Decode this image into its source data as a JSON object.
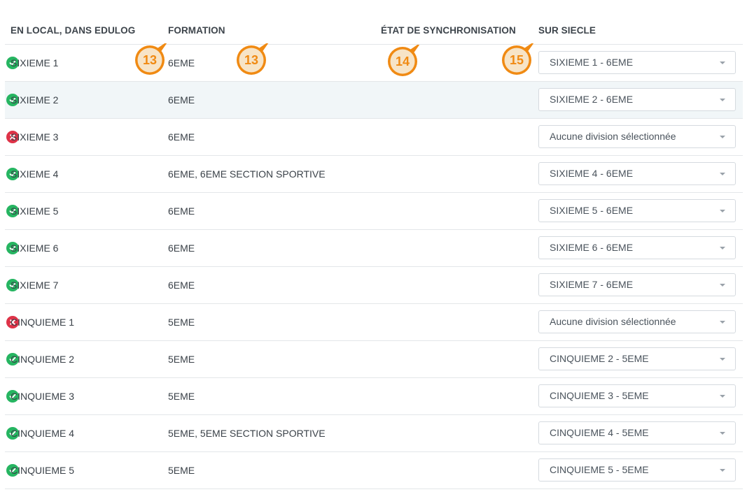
{
  "headers": {
    "local": "EN LOCAL, DANS EDULOG",
    "formation": "FORMATION",
    "sync": "ÉTAT DE SYNCHRONISATION",
    "siecle": "SUR SIECLE"
  },
  "rows": [
    {
      "local": "SIXIEME 1",
      "formation": "6EME",
      "status": "ok",
      "siecle": "SIXIEME 1 - 6EME"
    },
    {
      "local": "SIXIEME 2",
      "formation": "6EME",
      "status": "ok",
      "siecle": "SIXIEME 2 - 6EME"
    },
    {
      "local": "SIXIEME 3",
      "formation": "6EME",
      "status": "error",
      "siecle": "Aucune division sélectionnée"
    },
    {
      "local": "SIXIEME 4",
      "formation": "6EME, 6EME SECTION SPORTIVE",
      "status": "ok",
      "siecle": "SIXIEME 4 - 6EME"
    },
    {
      "local": "SIXIEME 5",
      "formation": "6EME",
      "status": "ok",
      "siecle": "SIXIEME 5 - 6EME"
    },
    {
      "local": "SIXIEME 6",
      "formation": "6EME",
      "status": "ok",
      "siecle": "SIXIEME 6 - 6EME"
    },
    {
      "local": "SIXIEME 7",
      "formation": "6EME",
      "status": "ok",
      "siecle": "SIXIEME 7 - 6EME"
    },
    {
      "local": "CINQUIEME 1",
      "formation": "5EME",
      "status": "error",
      "siecle": "Aucune division sélectionnée"
    },
    {
      "local": "CINQUIEME 2",
      "formation": "5EME",
      "status": "ok",
      "siecle": "CINQUIEME 2 - 5EME"
    },
    {
      "local": "CINQUIEME 3",
      "formation": "5EME",
      "status": "ok",
      "siecle": "CINQUIEME 3 - 5EME"
    },
    {
      "local": "CINQUIEME 4",
      "formation": "5EME, 5EME SECTION SPORTIVE",
      "status": "ok",
      "siecle": "CINQUIEME 4 - 5EME"
    },
    {
      "local": "CINQUIEME 5",
      "formation": "5EME",
      "status": "ok",
      "siecle": "CINQUIEME 5 - 5EME"
    }
  ],
  "annotations": [
    {
      "label": "13",
      "target": "local-column-header"
    },
    {
      "label": "13",
      "target": "formation-column-header"
    },
    {
      "label": "14",
      "target": "sync-column-header"
    },
    {
      "label": "15",
      "target": "siecle-column-header"
    }
  ],
  "colors": {
    "status_ok": "#26b561",
    "status_error": "#de3348",
    "annotation": "#f08a13",
    "row_highlight": "#f1f6f8"
  }
}
